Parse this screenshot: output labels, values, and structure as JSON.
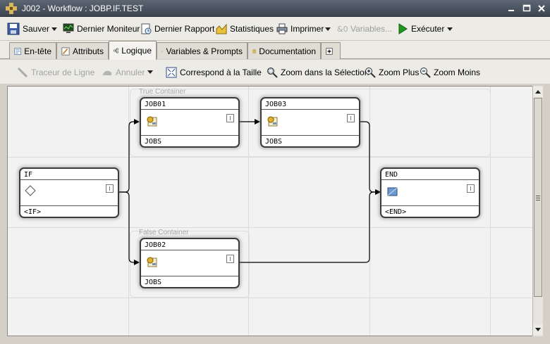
{
  "window": {
    "title": "J002 - Workflow : JOBP.IF.TEST"
  },
  "toolbar": {
    "save": "Sauver",
    "last_monitor": "Dernier Moniteur",
    "last_report": "Dernier Rapport",
    "statistics": "Statistiques",
    "print": "Imprimer",
    "variables": "Variables...",
    "execute": "Exécuter"
  },
  "tabs": [
    {
      "label": "En-tête"
    },
    {
      "label": "Attributs"
    },
    {
      "label": "Logique",
      "active": true
    },
    {
      "label": "Variables & Prompts"
    },
    {
      "label": "Documentation"
    }
  ],
  "editor_toolbar": {
    "line_tracer": "Traceur de Ligne",
    "undo": "Annuler",
    "fit_size": "Correspond à la Taille",
    "zoom_selection": "Zoom dans la Sélection",
    "zoom_in": "Zoom Plus",
    "zoom_out": "Zoom Moins"
  },
  "canvas": {
    "true_container": "True Container",
    "false_container": "False Container",
    "nodes": [
      {
        "id": "if",
        "name": "IF",
        "type": "<IF>",
        "icon": "diamond-icon"
      },
      {
        "id": "job01",
        "name": "JOB01",
        "type": "JOBS",
        "icon": "job-icon"
      },
      {
        "id": "job03",
        "name": "JOB03",
        "type": "JOBS",
        "icon": "job-icon"
      },
      {
        "id": "job02",
        "name": "JOB02",
        "type": "JOBS",
        "icon": "job-icon"
      },
      {
        "id": "end",
        "name": "END",
        "type": "<END>",
        "icon": "end-icon"
      }
    ]
  },
  "colors": {
    "titlebar": "#4a535f",
    "toolbar": "#ecebe6",
    "canvas": "#f2f2f2",
    "execute_green": "#1e9a1e"
  }
}
